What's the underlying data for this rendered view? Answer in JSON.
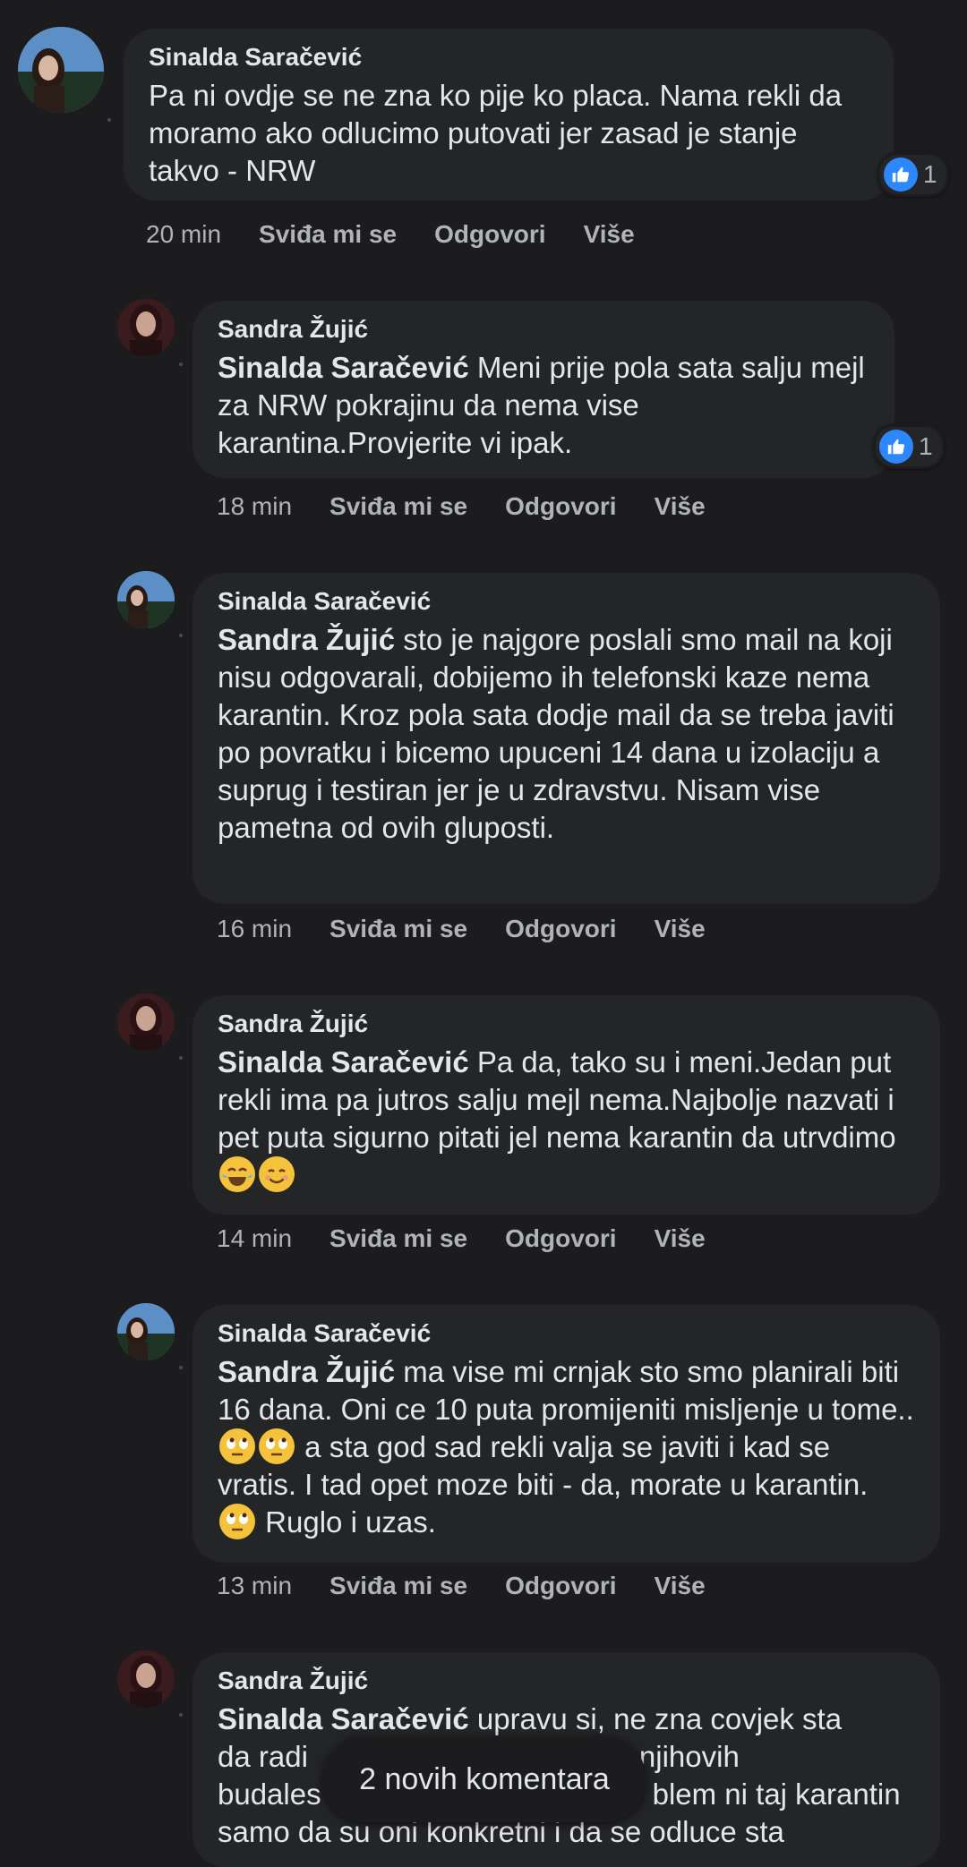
{
  "comments": [
    {
      "author": "Sinalda Saračević",
      "mention": "",
      "text": "Pa ni ovdje se ne zna ko pije ko placa. Nama rekli da moramo ako odlucimo putovati jer zasad je stanje takvo - NRW",
      "time": "20 min",
      "like": "Sviđa mi se",
      "reply": "Odgovori",
      "more": "Više",
      "reaction_count": "1"
    },
    {
      "author": "Sandra Žujić",
      "mention": "Sinalda Saračević",
      "text": "Meni prije pola sata salju mejl za NRW pokrajinu da nema vise karantina.Provjerite vi ipak.",
      "time": "18 min",
      "like": "Sviđa mi se",
      "reply": "Odgovori",
      "more": "Više",
      "reaction_count": "1"
    },
    {
      "author": "Sinalda Saračević",
      "mention": "Sandra Žujić",
      "text": "sto je najgore poslali smo mail na koji nisu odgovarali, dobijemo ih telefonski kaze nema karantin. Kroz pola sata dodje mail da se treba javiti po povratku i bicemo upuceni 14 dana u izolaciju a suprug i testiran jer je u zdravstvu. Nisam vise pametna od ovih gluposti.",
      "time": "16 min",
      "like": "Sviđa mi se",
      "reply": "Odgovori",
      "more": "Više"
    },
    {
      "author": "Sandra Žujić",
      "mention": "Sinalda Saračević",
      "text": "Pa da, tako su i meni.Jedan put rekli ima pa jutros salju mejl nema.Najbolje nazvati i pet puta sigurno pitati jel nema karantin da utrvdimo",
      "time": "14 min",
      "like": "Sviđa mi se",
      "reply": "Odgovori",
      "more": "Više"
    },
    {
      "author": "Sinalda Saračević",
      "mention": "Sandra Žujić",
      "text_a": "ma vise mi crnjak sto smo planirali biti 16 dana. Oni ce 10 puta promijeniti misljenje u tome..",
      "text_b": "a sta god sad rekli valja se javiti i kad se vratis. I tad opet moze biti - da, morate u karantin.",
      "text_c": "Ruglo i uzas.",
      "time": "13 min",
      "like": "Sviđa mi se",
      "reply": "Odgovori",
      "more": "Više"
    },
    {
      "author": "Sandra Žujić",
      "mention": "Sinalda Saračević",
      "line1": "upravu si, ne zna covjek sta",
      "line2a": "da radi",
      "line2b": "njihovih",
      "line3a": "budales",
      "line3b": "blem ni taj karantin",
      "line4": "samo da su oni konkretni i da se odluce sta"
    }
  ],
  "new_comments_label": "2 novih komentara",
  "colors": {
    "background": "#1c1c1e",
    "bubble": "#242526",
    "like_blue": "#2d88ff",
    "meta_text": "#b0b3b8"
  },
  "icons": [
    "like-icon",
    "avatar-scenic",
    "avatar-portrait",
    "rolling-eyes-emoji",
    "tears-of-joy-emoji",
    "smiling-emoji"
  ]
}
